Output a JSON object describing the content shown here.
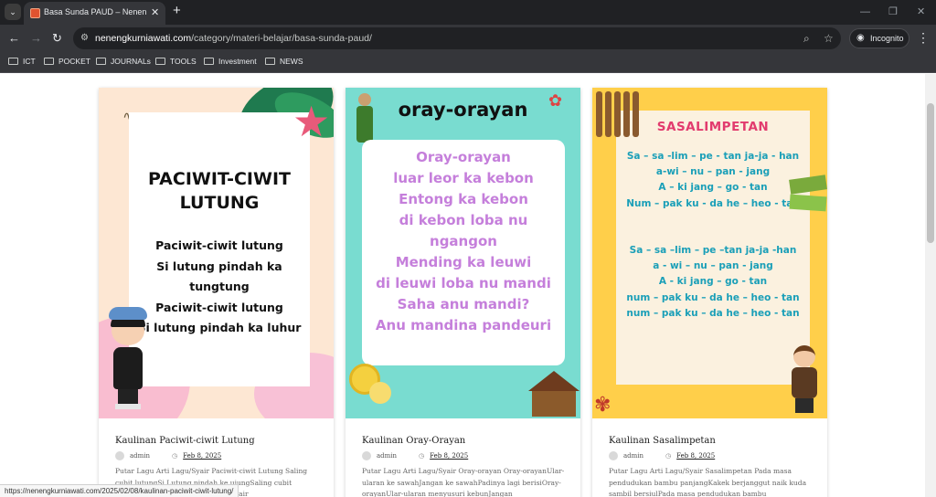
{
  "browser": {
    "tab_title": "Basa Sunda PAUD – Neneng Ku",
    "url_host": "nenengkurniawati.com",
    "url_path": "/category/materi-belajar/basa-sunda-paud/",
    "incognito_label": "Incognito",
    "bookmarks": [
      "ICT",
      "POCKET",
      "JOURNALs",
      "TOOLS",
      "Investment",
      "NEWS"
    ]
  },
  "posts": [
    {
      "title": "Kaulinan Paciwit-ciwit Lutung",
      "author": "admin",
      "date": "Feb 8, 2025",
      "excerpt": "Putar Lagu Arti Lagu/Syair Paciwit-ciwit Lutung Saling cubit lutungSi Lutung pindah ke ujungSaling cubit lutungSi Lutung pindah ke Lagu/Syair",
      "image": {
        "heading_lines": [
          "PACIWIT-CIWIT",
          "LUTUNG"
        ],
        "lyrics": [
          "Paciwit-ciwit lutung",
          "Si lutung pindah ka",
          "tungtung",
          "Paciwit-ciwit lutung",
          "Si lutung pindah ka luhur"
        ]
      }
    },
    {
      "title": "Kaulinan Oray-Orayan",
      "author": "admin",
      "date": "Feb 8, 2025",
      "excerpt": "Putar Lagu Arti Lagu/Syair Oray-orayan Oray-orayanUlar-ularan ke sawahJangan ke sawahPadinya lagi berisiOray-orayanUlar-ularan menyusuri kebunJangan",
      "image": {
        "heading": "oray-orayan",
        "lyrics": [
          "Oray-orayan",
          "luar leor ka kebon",
          "Entong ka kebon",
          "di kebon loba nu",
          "ngangon",
          "Mending ka leuwi",
          "di leuwi loba nu mandi",
          "Saha anu mandi?",
          "Anu mandina pandeuri"
        ]
      }
    },
    {
      "title": "Kaulinan Sasalimpetan",
      "author": "admin",
      "date": "Feb 8, 2025",
      "excerpt": "Putar Lagu Arti Lagu/Syair Sasalimpetan Pada masa pendudukan bambu panjangKakek berjanggut naik kuda sambil bersiulPada masa pendudukan bambu",
      "image": {
        "heading": "SASALIMPETAN",
        "stanza1": [
          "Sa – sa -lim – pe - tan  ja-ja - han",
          "a-wi – nu – pan - jang",
          "A – ki     jang – go - tan",
          "Num – pak   ku - da    he – heo - tan"
        ],
        "stanza2": [
          "Sa – sa –lim – pe –tan ja-ja -han",
          "a - wi – nu – pan - jang",
          "A - ki      jang – go - tan",
          "num – pak    ku – da    he – heo - tan",
          "num – pak    ku – da    he – heo - tan"
        ]
      }
    }
  ],
  "status_bar_url": "https://nenengkurniawati.com/2025/02/08/kaulinan-paciwit-ciwit-lutung/"
}
